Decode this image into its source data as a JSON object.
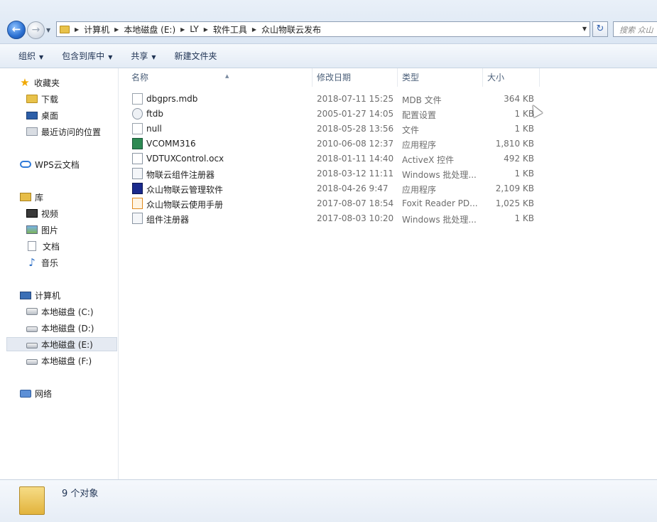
{
  "address_bar": {
    "breadcrumbs": [
      "计算机",
      "本地磁盘 (E:)",
      "LY",
      "软件工具",
      "众山物联云发布"
    ],
    "search_placeholder": "搜索 众山"
  },
  "toolbar": {
    "organize": "组织",
    "include_in_library": "包含到库中",
    "share": "共享",
    "new_folder": "新建文件夹"
  },
  "sidebar": {
    "favorites": "收藏夹",
    "downloads": "下载",
    "desktop": "桌面",
    "recent": "最近访问的位置",
    "wps": "WPS云文档",
    "libraries": "库",
    "videos": "视频",
    "pictures": "图片",
    "documents": "文档",
    "music": "音乐",
    "computer": "计算机",
    "drives": [
      "本地磁盘 (C:)",
      "本地磁盘 (D:)",
      "本地磁盘 (E:)",
      "本地磁盘 (F:)"
    ],
    "network": "网络"
  },
  "columns": {
    "name": "名称",
    "date": "修改日期",
    "type": "类型",
    "size": "大小"
  },
  "files": [
    {
      "name": "dbgprs.mdb",
      "date": "2018-07-11 15:25",
      "type": "MDB 文件",
      "size": "364 KB",
      "icon": "mdb-file-icon"
    },
    {
      "name": "ftdb",
      "date": "2005-01-27 14:05",
      "type": "配置设置",
      "size": "1 KB",
      "icon": "config-file-icon"
    },
    {
      "name": "null",
      "date": "2018-05-28 13:56",
      "type": "文件",
      "size": "1 KB",
      "icon": "blank-file-icon"
    },
    {
      "name": "VCOMM316",
      "date": "2010-06-08 12:37",
      "type": "应用程序",
      "size": "1,810 KB",
      "icon": "app-icon"
    },
    {
      "name": "VDTUXControl.ocx",
      "date": "2018-01-11 14:40",
      "type": "ActiveX 控件",
      "size": "492 KB",
      "icon": "activex-icon"
    },
    {
      "name": "物联云组件注册器",
      "date": "2018-03-12 11:11",
      "type": "Windows 批处理...",
      "size": "1 KB",
      "icon": "batch-file-icon"
    },
    {
      "name": "众山物联云管理软件",
      "date": "2018-04-26 9:47",
      "type": "应用程序",
      "size": "2,109 KB",
      "icon": "app-icon"
    },
    {
      "name": "众山物联云使用手册",
      "date": "2017-08-07 18:54",
      "type": "Foxit Reader PD...",
      "size": "1,025 KB",
      "icon": "pdf-file-icon"
    },
    {
      "name": "组件注册器",
      "date": "2017-08-03 10:20",
      "type": "Windows 批处理...",
      "size": "1 KB",
      "icon": "batch-file-icon"
    }
  ],
  "status": {
    "item_count": "9 个对象"
  }
}
